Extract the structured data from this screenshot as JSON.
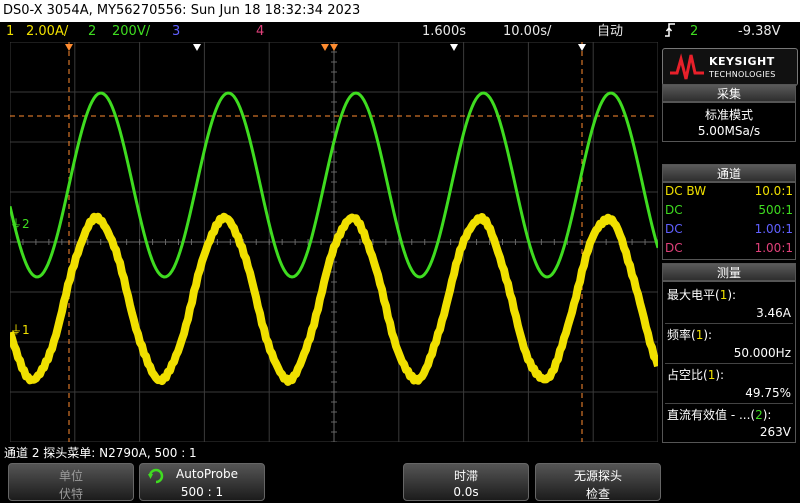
{
  "title_bar": "DS0-X 3054A, MY56270556: Sun Jun 18 18:32:34 2023",
  "top_bar": {
    "ch1_num": "1",
    "ch1_scale": "2.00A/",
    "ch2_num": "2",
    "ch2_scale": "200V/",
    "ch3_num": "3",
    "ch4_num": "4",
    "delay": "1.600s",
    "timebase": "10.00s/",
    "trigger_mode": "自动",
    "trigger_channel": "2",
    "trigger_level": "-9.38V",
    "trigger_icon": "rising-edge-icon"
  },
  "colors": {
    "ch1": "#f0e000",
    "ch2": "#3fdc20",
    "ch3": "#6060ff",
    "ch4": "#e0407a",
    "cursor": "#ff8c30",
    "grid": "#3a3a3a"
  },
  "waveform": {
    "ch1_label": "1",
    "ch2_label": "2",
    "ch1_frequency_hz": 50,
    "ch1_peak_a": 3.46,
    "ch2_vrms_v": 263
  },
  "panel": {
    "logo_line1": "KEYSIGHT",
    "logo_line2": "TECHNOLOGIES",
    "logo_icon": "keysight-wave-icon",
    "acq_header": "采集",
    "acq_mode": "标准模式",
    "acq_rate": "5.00MSa/s",
    "channels_header": "通道",
    "channels": [
      {
        "coupling": "DC BW",
        "ratio": "10.0:1"
      },
      {
        "coupling": "DC",
        "ratio": "500:1"
      },
      {
        "coupling": "DC",
        "ratio": "1.00:1"
      },
      {
        "coupling": "DC",
        "ratio": "1.00:1"
      }
    ],
    "meas_header": "测量",
    "measurements": [
      {
        "name": "最大电平",
        "src": "1",
        "value": "3.46A"
      },
      {
        "name": "频率",
        "src": "1",
        "value": "50.000Hz"
      },
      {
        "name": "占空比",
        "src": "1",
        "value": "49.75%"
      },
      {
        "name": "直流有效值 - ...",
        "src": "2",
        "value": "263V"
      }
    ]
  },
  "status_line": "通道 2 探头菜单: N2790A, 500 : 1",
  "softkeys": [
    {
      "line1": "单位",
      "line2": "伏特"
    },
    {
      "line1": "AutoProbe",
      "line2": "500 : 1",
      "icon": "autoprobe-knob-icon"
    },
    {
      "line1": "时滞",
      "line2": "0.0s"
    },
    {
      "line1": "无源探头",
      "line2": "检查"
    }
  ]
}
